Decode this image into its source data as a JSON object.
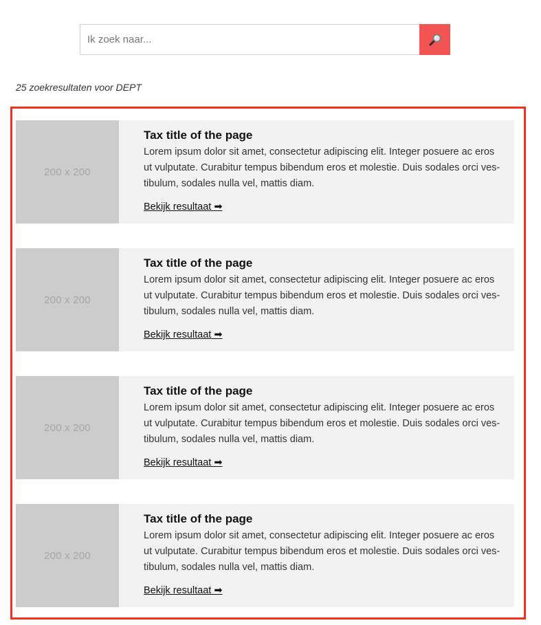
{
  "search": {
    "placeholder": "Ik zoek naar...",
    "value": "",
    "button_icon": "magnifier-icon",
    "button_color": "#f25454"
  },
  "result_count_text": "25 zoekresultaten voor DEPT",
  "results": [
    {
      "thumbnail_label": "200 x 200",
      "title": "Tax title of the page",
      "text": "Lorem ipsum dolor sit amet, consectetur adipiscing elit. Integer posuere ac eros ut vulputate. Curabitur tempus bibendum eros et molestie. Duis sodales orci ves-tibulum, sodales nulla vel, mattis diam.",
      "link_label": "Bekijk resultaat ➡"
    },
    {
      "thumbnail_label": "200 x 200",
      "title": "Tax title of the page",
      "text": "Lorem ipsum dolor sit amet, consectetur adipiscing elit. Integer posuere ac eros ut vulputate. Curabitur tempus bibendum eros et molestie. Duis sodales orci ves-tibulum, sodales nulla vel, mattis diam.",
      "link_label": "Bekijk resultaat ➡"
    },
    {
      "thumbnail_label": "200 x 200",
      "title": "Tax title of the page",
      "text": "Lorem ipsum dolor sit amet, consectetur adipiscing elit. Integer posuere ac eros ut vulputate. Curabitur tempus bibendum eros et molestie. Duis sodales orci ves-tibulum, sodales nulla vel, mattis diam.",
      "link_label": "Bekijk resultaat ➡"
    },
    {
      "thumbnail_label": "200 x 200",
      "title": "Tax title of the page",
      "text": "Lorem ipsum dolor sit amet, consectetur adipiscing elit. Integer posuere ac eros ut vulputate. Curabitur tempus bibendum eros et molestie. Duis sodales orci ves-tibulum, sodales nulla vel, mattis diam.",
      "link_label": "Bekijk resultaat ➡"
    }
  ],
  "colors": {
    "highlight_border": "#f2301f",
    "card_background": "#f2f2f2",
    "thumbnail_background": "#cccccc"
  }
}
